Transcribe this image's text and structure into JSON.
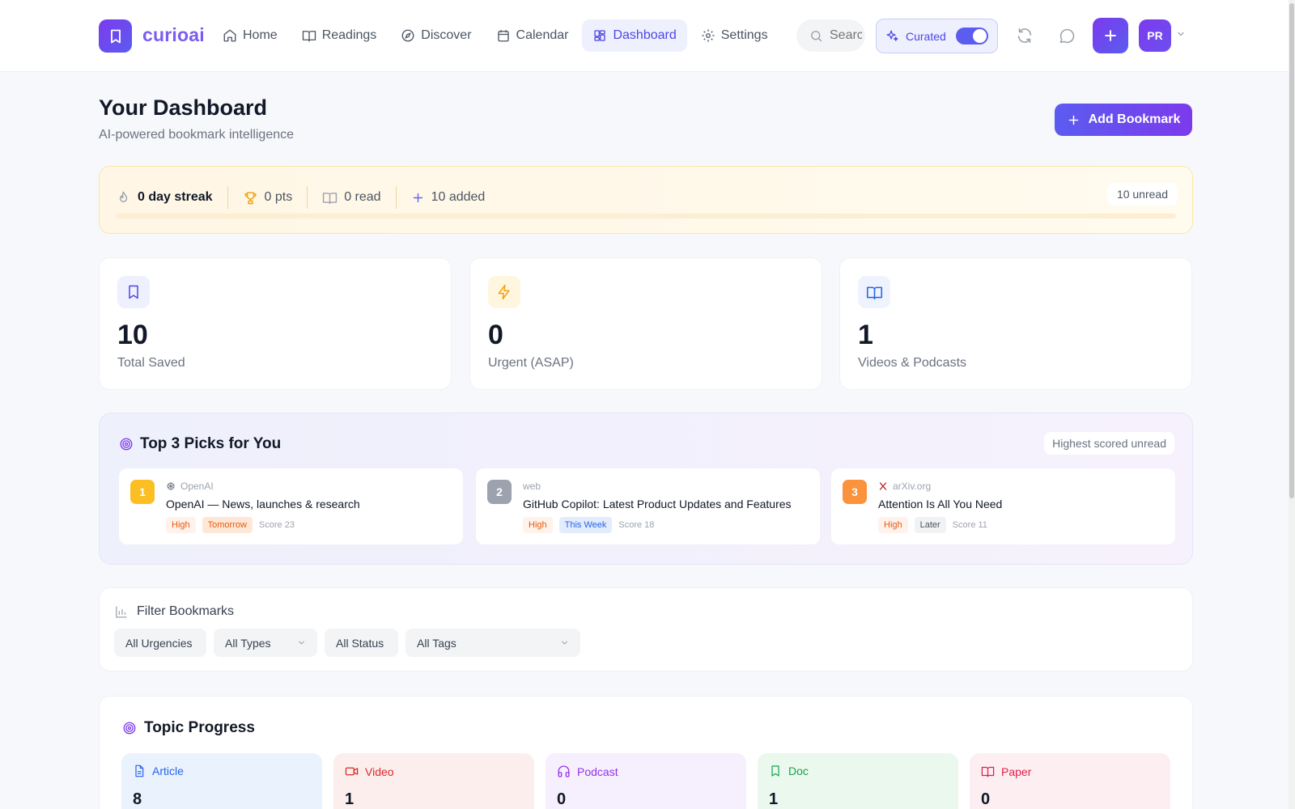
{
  "header": {
    "brand": "curioai",
    "nav": [
      {
        "label": "Home",
        "icon": "home-icon"
      },
      {
        "label": "Readings",
        "icon": "book-open-icon"
      },
      {
        "label": "Discover",
        "icon": "compass-icon"
      },
      {
        "label": "Calendar",
        "icon": "calendar-icon"
      },
      {
        "label": "Dashboard",
        "icon": "dashboard-icon",
        "active": true
      },
      {
        "label": "Settings",
        "icon": "gear-icon"
      }
    ],
    "search_placeholder": "Search",
    "curated_label": "Curated",
    "curated_on": true,
    "avatar_initials": "PR",
    "accent": "#5b5cf0"
  },
  "page": {
    "title": "Your Dashboard",
    "subtitle": "AI-powered bookmark intelligence",
    "add_button": "Add Bookmark"
  },
  "streak": {
    "streak": "0 day streak",
    "points": "0 pts",
    "read": "0 read",
    "added": "10 added",
    "unread": "10 unread"
  },
  "stats": [
    {
      "value": "10",
      "label": "Total Saved",
      "icon": "bookmark-icon",
      "color": "#4f46e5"
    },
    {
      "value": "0",
      "label": "Urgent (ASAP)",
      "icon": "lightning-icon",
      "color": "#f59e0b"
    },
    {
      "value": "1",
      "label": "Videos & Podcasts",
      "icon": "book-open-icon",
      "color": "#2563eb"
    }
  ],
  "picks": {
    "title": "Top 3 Picks for You",
    "badge": "Highest scored unread",
    "items": [
      {
        "rank": "1",
        "rank_color": "#fbbf24",
        "source": "OpenAI",
        "title": "OpenAI — News, launches & research",
        "priority": "High",
        "when": "Tomorrow",
        "score": "Score 23"
      },
      {
        "rank": "2",
        "rank_color": "#9ca3af",
        "source": "web",
        "title": "GitHub Copilot: Latest Product Updates and Features",
        "priority": "High",
        "when": "This Week",
        "score": "Score 18"
      },
      {
        "rank": "3",
        "rank_color": "#fb923c",
        "source": "arXiv.org",
        "title": "Attention Is All You Need",
        "priority": "High",
        "when": "Later",
        "score": "Score 11"
      }
    ]
  },
  "filters": {
    "title": "Filter Bookmarks",
    "selects": [
      "All Urgencies",
      "All Types",
      "All Status",
      "All Tags"
    ]
  },
  "topics": {
    "title": "Topic Progress",
    "items": [
      {
        "label": "Article",
        "value": "8",
        "icon": "document-icon",
        "color": "#2563eb",
        "bg": "#eaf2fe"
      },
      {
        "label": "Video",
        "value": "1",
        "icon": "video-icon",
        "color": "#dc2626",
        "bg": "#fdeeee"
      },
      {
        "label": "Podcast",
        "value": "0",
        "icon": "headphones-icon",
        "color": "#9333ea",
        "bg": "#f6effd"
      },
      {
        "label": "Doc",
        "value": "1",
        "icon": "bookmark-icon",
        "color": "#16a34a",
        "bg": "#ebf8ee"
      },
      {
        "label": "Paper",
        "value": "0",
        "icon": "book-open-icon",
        "color": "#e11d48",
        "bg": "#fdeff1"
      }
    ]
  }
}
